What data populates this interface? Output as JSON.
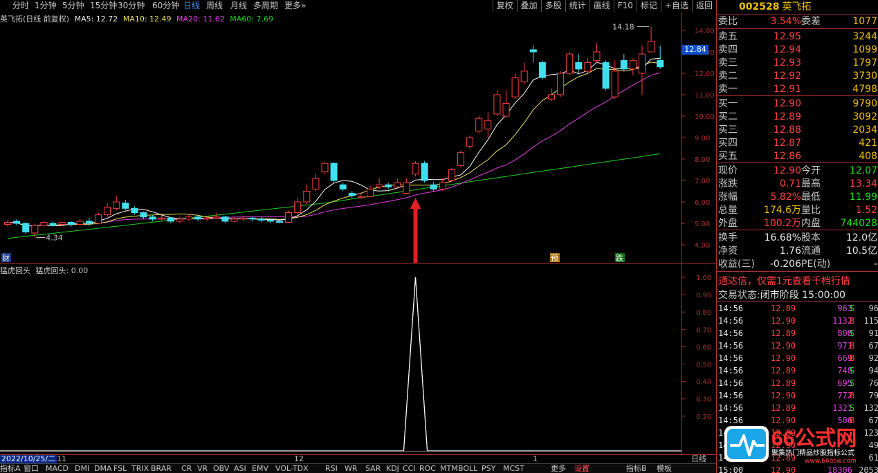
{
  "period_tabs": [
    "分时",
    "1分钟",
    "5分钟",
    "15分钟",
    "30分钟",
    "60分钟",
    "日线",
    "周线",
    "月线",
    "多周期",
    "更多»"
  ],
  "period_active": "日线",
  "toolbar_right": [
    "复权",
    "叠加",
    "多股",
    "统计",
    "画线",
    "F10",
    "标记",
    "+自选",
    "返回"
  ],
  "chart_title": "英飞拓(日线 前复权)",
  "ma": {
    "ma5": "MA5: 12.72",
    "ma10": "MA10: 12.49",
    "ma20": "MA20: 11.62",
    "ma60": "MA60: 7.69"
  },
  "indicator_name": "猛虎回头",
  "indicator_value": "猛虎回头: 0.00",
  "price_axis": [
    "14.00",
    "13.00",
    "12.00",
    "11.00",
    "10.00",
    "9.00",
    "8.00",
    "7.00",
    "6.00",
    "5.00",
    "4.00"
  ],
  "ind_axis": [
    "1.00",
    "0.90",
    "0.80",
    "0.70",
    "0.60",
    "0.50",
    "0.40",
    "0.30",
    "0.20"
  ],
  "current_price_tag": "12.84",
  "high_label": "14.18",
  "low_label": "4.34",
  "markers": {
    "cai": "财",
    "yu": "预",
    "die": "跌"
  },
  "date_label": "2022/10/25/二",
  "month_ticks": [
    "11",
    "12",
    "1"
  ],
  "period_label": "日线",
  "bottom_tabs": [
    "指标A",
    "窗口",
    "MACD",
    "DMI",
    "DMA",
    "FSL",
    "TRIX",
    "BRAR",
    "CR",
    "VR",
    "OBV",
    "ASI",
    "EMV",
    "VOL-TDX",
    "RSI",
    "WR",
    "SAR",
    "KDJ",
    "CCI",
    "ROC",
    "MTM",
    "BOLL",
    "PSY",
    "MCST",
    "更多",
    "设置",
    "指标B",
    "模板"
  ],
  "bottom_active": "设置",
  "stock": {
    "code": "002528",
    "name": "英飞拓"
  },
  "quote": {
    "webi": {
      "label": "委比",
      "value": "3.54%",
      "label2": "委差",
      "value2": "1077"
    },
    "asks": [
      {
        "label": "卖五",
        "price": "12.95",
        "vol": "3244"
      },
      {
        "label": "卖四",
        "price": "12.94",
        "vol": "1099"
      },
      {
        "label": "卖三",
        "price": "12.93",
        "vol": "1797"
      },
      {
        "label": "卖二",
        "price": "12.92",
        "vol": "3730"
      },
      {
        "label": "卖一",
        "price": "12.91",
        "vol": "4798"
      }
    ],
    "bids": [
      {
        "label": "买一",
        "price": "12.90",
        "vol": "9790"
      },
      {
        "label": "买二",
        "price": "12.89",
        "vol": "3092"
      },
      {
        "label": "买三",
        "price": "12.88",
        "vol": "2034"
      },
      {
        "label": "买四",
        "price": "12.87",
        "vol": "421"
      },
      {
        "label": "买五",
        "price": "12.86",
        "vol": "408"
      }
    ],
    "stats": [
      {
        "l1": "现价",
        "v1": "12.90",
        "c1": "red",
        "l2": "今开",
        "v2": "12.07",
        "c2": "grn"
      },
      {
        "l1": "涨跌",
        "v1": "0.71",
        "c1": "red",
        "l2": "最高",
        "v2": "13.34",
        "c2": "red"
      },
      {
        "l1": "涨幅",
        "v1": "5.82%",
        "c1": "red",
        "l2": "最低",
        "v2": "11.99",
        "c2": "grn"
      },
      {
        "l1": "总量",
        "v1": "174.6万",
        "c1": "yel",
        "l2": "量比",
        "v2": "1.52",
        "c2": "red"
      },
      {
        "l1": "外盘",
        "v1": "100.2万",
        "c1": "red",
        "l2": "内盘",
        "v2": "744028",
        "c2": "grn"
      }
    ],
    "stats2": [
      {
        "l1": "换手",
        "v1": "16.68%",
        "c1": "wht",
        "l2": "股本",
        "v2": "12.0亿",
        "c2": "wht"
      },
      {
        "l1": "净资",
        "v1": "1.76",
        "c1": "wht",
        "l2": "流通",
        "v2": "10.5亿",
        "c2": "wht"
      },
      {
        "l1": "收益(三)",
        "v1": "-0.206",
        "c1": "wht",
        "l2": "PE(动)",
        "v2": "-",
        "c2": "wht"
      }
    ]
  },
  "promo": "通达信，仅需1元查看千档行情",
  "trade_status_label": "交易状态:",
  "trade_status_value": "闭市阶段 15:00:00",
  "ticks": [
    {
      "time": "14:56",
      "price": "12.89",
      "vol": "963",
      "bs": "S",
      "n": "96"
    },
    {
      "time": "14:56",
      "price": "12.90",
      "vol": "1132",
      "bs": "B",
      "n": "115"
    },
    {
      "time": "14:56",
      "price": "12.89",
      "vol": "808",
      "bs": "S",
      "n": "91"
    },
    {
      "time": "14:56",
      "price": "12.90",
      "vol": "971",
      "bs": "B",
      "n": "67"
    },
    {
      "time": "14:56",
      "price": "12.90",
      "vol": "669",
      "bs": "B",
      "n": "92"
    },
    {
      "time": "14:56",
      "price": "12.89",
      "vol": "748",
      "bs": "S",
      "n": "94"
    },
    {
      "time": "14:56",
      "price": "12.89",
      "vol": "695",
      "bs": "S",
      "n": "76"
    },
    {
      "time": "14:56",
      "price": "12.90",
      "vol": "772",
      "bs": "B",
      "n": "79"
    },
    {
      "time": "14:56",
      "price": "12.89",
      "vol": "1321",
      "bs": "S",
      "n": "132"
    },
    {
      "time": "14:56",
      "price": "12.90",
      "vol": "506",
      "bs": "B",
      "n": "67"
    },
    {
      "time": "14:56",
      "price": "12.89",
      "vol": "",
      "bs": "",
      "n": "123"
    },
    {
      "time": "14:56",
      "price": "12.90",
      "vol": "",
      "bs": "",
      "n": "49"
    },
    {
      "time": "14:56",
      "price": "12.89",
      "vol": "",
      "bs": "",
      "n": "61"
    },
    {
      "time": "15:00",
      "price": "12.90",
      "vol": "18306",
      "bs": "",
      "n": "2053"
    }
  ],
  "logo": {
    "text": "66公式网",
    "sub": "聚集热门精品炒股指标公式",
    "url": "www.66gsw.com"
  },
  "colors": {
    "up": "#ff4040",
    "down": "#40e0f0",
    "ma5": "#ffffff",
    "ma10": "#f0e060",
    "ma20": "#e040e0",
    "ma60": "#20d020",
    "grid": "#b03030"
  },
  "chart_data": {
    "type": "candlestick",
    "ylim": [
      3.6,
      14.4
    ],
    "candles": [
      [
        4.95,
        5.05,
        5.15,
        4.85
      ],
      [
        5.1,
        5.0,
        5.2,
        4.9
      ],
      [
        5.0,
        4.6,
        5.05,
        4.5
      ],
      [
        4.55,
        4.9,
        5.0,
        4.34
      ],
      [
        4.9,
        5.05,
        5.1,
        4.85
      ],
      [
        5.0,
        4.9,
        5.1,
        4.85
      ],
      [
        4.95,
        5.05,
        5.1,
        4.9
      ],
      [
        5.05,
        4.95,
        5.1,
        4.85
      ],
      [
        4.95,
        5.1,
        5.2,
        4.9
      ],
      [
        5.1,
        5.0,
        5.25,
        4.9
      ],
      [
        5.0,
        5.4,
        5.5,
        4.95
      ],
      [
        5.4,
        5.75,
        5.95,
        5.3
      ],
      [
        5.7,
        6.0,
        6.3,
        5.6
      ],
      [
        5.95,
        5.7,
        6.1,
        5.6
      ],
      [
        5.7,
        5.5,
        5.8,
        5.4
      ],
      [
        5.5,
        5.3,
        5.55,
        5.2
      ],
      [
        5.3,
        5.2,
        5.4,
        5.1
      ],
      [
        5.2,
        5.25,
        5.4,
        5.1
      ],
      [
        5.25,
        5.1,
        5.3,
        5.0
      ],
      [
        5.1,
        5.2,
        5.3,
        5.0
      ],
      [
        5.2,
        5.3,
        5.45,
        5.1
      ],
      [
        5.3,
        5.2,
        5.4,
        5.1
      ],
      [
        5.2,
        5.25,
        5.35,
        5.1
      ],
      [
        5.25,
        5.3,
        5.5,
        5.2
      ],
      [
        5.3,
        5.1,
        5.35,
        5.0
      ],
      [
        5.1,
        5.2,
        5.3,
        5.05
      ],
      [
        5.2,
        5.25,
        5.35,
        5.1
      ],
      [
        5.25,
        5.2,
        5.3,
        5.1
      ],
      [
        5.2,
        5.15,
        5.3,
        5.05
      ],
      [
        5.15,
        5.1,
        5.2,
        5.0
      ],
      [
        5.1,
        5.05,
        5.15,
        5.0
      ],
      [
        5.05,
        5.5,
        5.6,
        5.0
      ],
      [
        5.5,
        6.0,
        6.2,
        5.45
      ],
      [
        6.0,
        6.5,
        6.8,
        5.9
      ],
      [
        6.6,
        7.1,
        7.3,
        6.5
      ],
      [
        7.4,
        7.8,
        7.85,
        7.3
      ],
      [
        7.8,
        7.0,
        7.85,
        6.9
      ],
      [
        6.8,
        6.6,
        6.9,
        6.5
      ],
      [
        6.4,
        6.3,
        6.5,
        6.2
      ],
      [
        6.2,
        6.25,
        6.4,
        6.15
      ],
      [
        6.25,
        6.6,
        6.75,
        6.2
      ],
      [
        6.7,
        6.8,
        7.1,
        6.6
      ],
      [
        6.8,
        6.7,
        6.9,
        6.6
      ],
      [
        6.7,
        6.9,
        7.1,
        6.6
      ],
      [
        6.4,
        6.9,
        7.1,
        6.35
      ],
      [
        7.3,
        7.8,
        7.9,
        7.2
      ],
      [
        7.8,
        7.0,
        7.9,
        6.9
      ],
      [
        6.8,
        6.6,
        6.95,
        6.5
      ],
      [
        6.6,
        6.9,
        7.1,
        6.5
      ],
      [
        7.0,
        7.5,
        7.6,
        6.95
      ],
      [
        7.7,
        8.3,
        8.4,
        7.6
      ],
      [
        8.6,
        9.0,
        9.1,
        8.5
      ],
      [
        9.3,
        9.9,
        10.0,
        9.2
      ],
      [
        9.4,
        9.8,
        10.2,
        9.0
      ],
      [
        10.1,
        11.0,
        11.2,
        10.0
      ],
      [
        10.0,
        10.6,
        11.2,
        9.95
      ],
      [
        10.9,
        11.8,
        12.0,
        10.8
      ],
      [
        11.6,
        12.1,
        12.5,
        11.5
      ],
      [
        13.1,
        13.0,
        13.3,
        12.5
      ],
      [
        12.5,
        11.8,
        12.6,
        11.7
      ],
      [
        10.8,
        11.0,
        11.3,
        10.7
      ],
      [
        11.0,
        12.0,
        12.1,
        10.9
      ],
      [
        12.0,
        12.9,
        13.0,
        11.9
      ],
      [
        12.5,
        12.2,
        12.9,
        12.0
      ],
      [
        12.1,
        12.5,
        12.7,
        12.0
      ],
      [
        12.6,
        13.0,
        13.4,
        12.5
      ],
      [
        12.5,
        11.3,
        12.6,
        11.2
      ],
      [
        10.9,
        12.1,
        12.6,
        10.8
      ],
      [
        12.6,
        12.2,
        12.9,
        12.1
      ],
      [
        12.2,
        12.6,
        12.7,
        11.9
      ],
      [
        12.0,
        12.9,
        13.3,
        11.0
      ],
      [
        13.0,
        13.5,
        14.18,
        13.0
      ],
      [
        12.6,
        12.3,
        13.3,
        12.2
      ]
    ],
    "ind_series": "x-peak at bar 40 value 1.00"
  }
}
